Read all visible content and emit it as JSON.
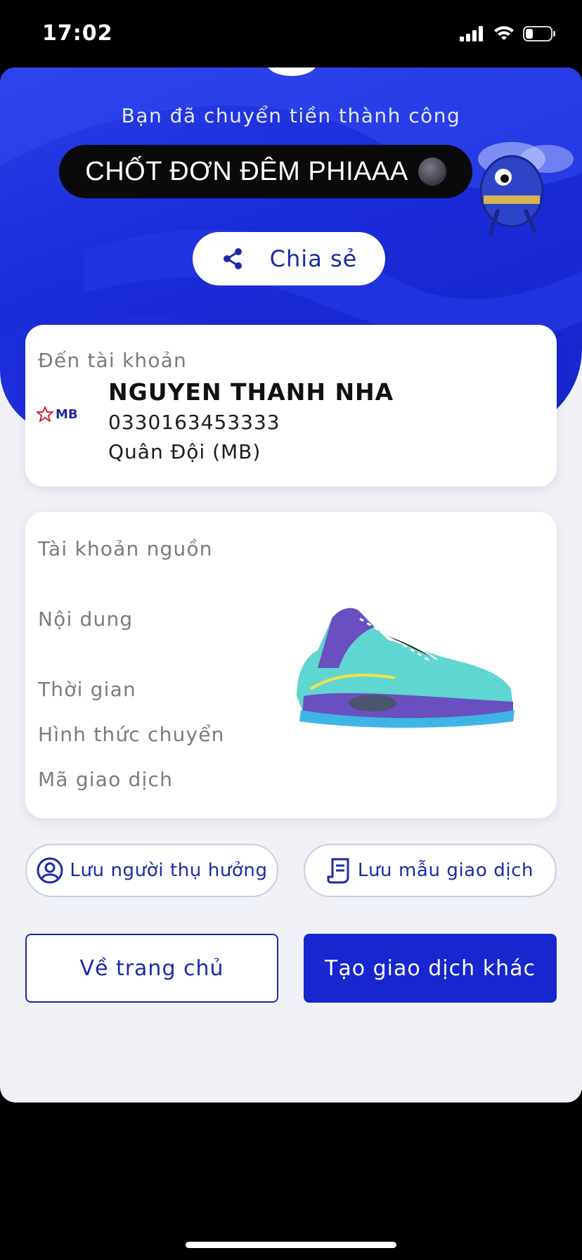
{
  "status_bar": {
    "time": "17:02",
    "icons": [
      "cellular-signal-icon",
      "wifi-icon",
      "battery-icon"
    ]
  },
  "hero": {
    "success_message": "Bạn đã chuyển tiền thành công",
    "caption": "CHỐT ĐƠN ĐÊM PHIAAA",
    "caption_emoji": "new-moon-face-icon",
    "share_label": "Chia sẻ"
  },
  "destination": {
    "label": "Đến tài khoản",
    "name": "NGUYEN THANH NHA",
    "account_number": "0330163453333",
    "bank": "Quân Đội (MB)",
    "bank_logo_text": "MB"
  },
  "details": {
    "source_account_label": "Tài khoản nguồn",
    "content_label": "Nội dung",
    "time_label": "Thời gian",
    "transfer_type_label": "Hình thức chuyển",
    "transaction_id_label": "Mã giao dịch"
  },
  "actions": {
    "save_payee": "Lưu người thụ hưởng",
    "save_template": "Lưu mẫu giao dịch",
    "home": "Về trang chủ",
    "new_transaction": "Tạo giao dịch khác"
  },
  "colors": {
    "brand_blue": "#1826d0",
    "accent_text": "#1c2aa8",
    "background": "#f0f1f6"
  }
}
